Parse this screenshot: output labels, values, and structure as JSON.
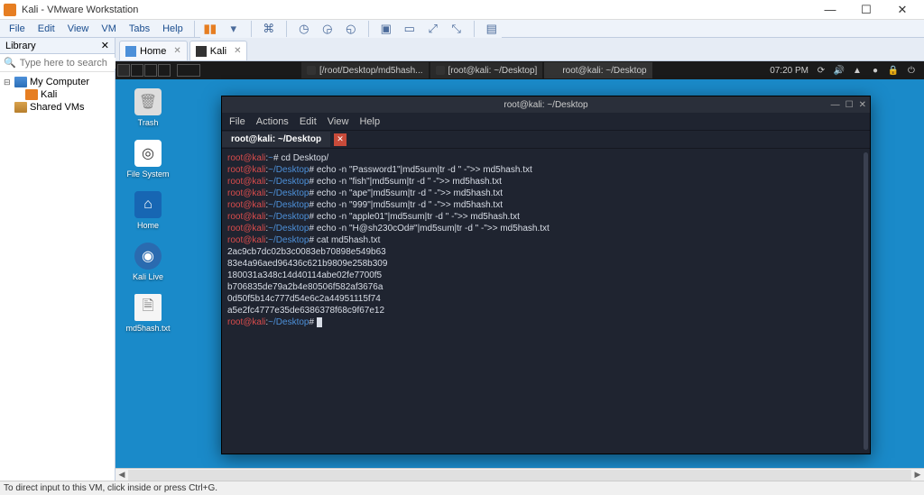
{
  "window": {
    "title": "Kali - VMware Workstation"
  },
  "menu": {
    "file": "File",
    "edit": "Edit",
    "view": "View",
    "vm": "VM",
    "tabs": "Tabs",
    "help": "Help"
  },
  "wincontrols": {
    "min": "—",
    "max": "☐",
    "close": "✕"
  },
  "sidebar": {
    "header": "Library",
    "close": "✕",
    "search_placeholder": "Type here to search",
    "items": [
      "My Computer",
      "Kali",
      "Shared VMs"
    ]
  },
  "vmtabs": {
    "home": "Home",
    "kali": "Kali"
  },
  "kali_panel": {
    "tasks": [
      "[/root/Desktop/md5hash...",
      "[root@kali: ~/Desktop]",
      "root@kali: ~/Desktop"
    ],
    "time": "07:20 PM"
  },
  "desktop_icons": [
    "Trash",
    "File System",
    "Home",
    "Kali Live",
    "md5hash.txt"
  ],
  "terminal": {
    "title": "root@kali: ~/Desktop",
    "menu": [
      "File",
      "Actions",
      "Edit",
      "View",
      "Help"
    ],
    "tab": "root@kali: ~/Desktop",
    "prompt_user": "root@kali",
    "prompt_path": "~/Desktop",
    "lines": [
      {
        "cmd": "cd Desktop/",
        "path": "~"
      },
      {
        "cmd": "echo -n \"Password1\"|md5sum|tr -d \" -\">> md5hash.txt"
      },
      {
        "cmd": "echo -n \"fish\"|md5sum|tr -d \" -\">> md5hash.txt"
      },
      {
        "cmd": "echo -n \"ape\"|md5sum|tr -d \" -\">> md5hash.txt"
      },
      {
        "cmd": "echo -n \"999\"|md5sum|tr -d \" -\">> md5hash.txt"
      },
      {
        "cmd": "echo -n \"apple01\"|md5sum|tr -d \" -\">> md5hash.txt"
      },
      {
        "cmd": "echo -n \"H@sh230cOd#\"|md5sum|tr -d \" -\">> md5hash.txt"
      },
      {
        "cmd": "cat md5hash.txt"
      }
    ],
    "output": [
      "2ac9cb7dc02b3c0083eb70898e549b63",
      "83e4a96aed96436c621b9809e258b309",
      "180031a348c14d40114abe02fe7700f5",
      "b706835de79a2b4e80506f582af3676a",
      "0d50f5b14c777d54e6c2a44951115f74",
      "a5e2fc4777e35de6386378f68c9f67e12"
    ]
  },
  "statusbar": "To direct input to this VM, click inside or press Ctrl+G."
}
